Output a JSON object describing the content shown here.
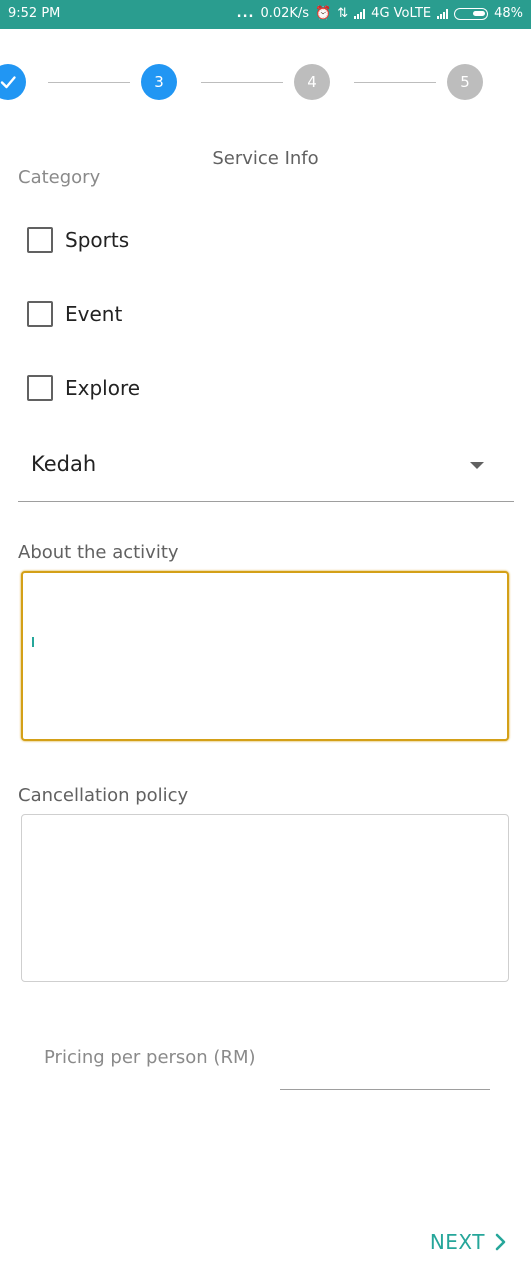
{
  "status_bar": {
    "time": "9:52 PM",
    "dots": "...",
    "speed": "0.02K/s",
    "network": "4G VoLTE",
    "battery": "48%"
  },
  "stepper": {
    "steps": [
      {
        "label": "",
        "state": "done"
      },
      {
        "label": "3",
        "state": "active"
      },
      {
        "label": "4",
        "state": "pending"
      },
      {
        "label": "5",
        "state": "pending"
      }
    ]
  },
  "page": {
    "title": "Service Info"
  },
  "category": {
    "label": "Category",
    "options": [
      {
        "label": "Sports",
        "checked": false
      },
      {
        "label": "Event",
        "checked": false
      },
      {
        "label": "Explore",
        "checked": false
      }
    ]
  },
  "state_select": {
    "value": "Kedah"
  },
  "about": {
    "label": "About the activity",
    "value": ""
  },
  "cancellation": {
    "label": "Cancellation policy",
    "value": ""
  },
  "pricing": {
    "placeholder": "Pricing per person (RM)",
    "value": ""
  },
  "footer": {
    "next_label": "NEXT"
  },
  "colors": {
    "status_bar": "#2a9d8f",
    "accent_blue": "#2196f3",
    "accent_teal": "#26a69a",
    "focus_border": "#d4a017",
    "pending_gray": "#bdbdbd"
  }
}
